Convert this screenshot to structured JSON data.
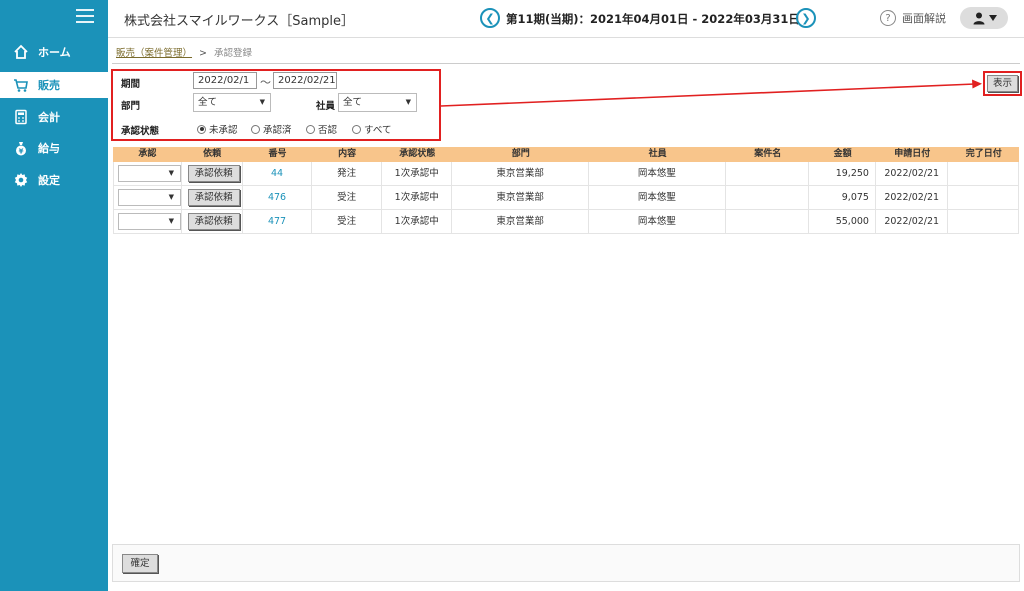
{
  "colors": {
    "sidebar": "#1b92b9",
    "accent": "#1b92b9",
    "table_header": "#f8c58b",
    "highlight_border": "#e12020"
  },
  "sidebar": {
    "items": [
      {
        "label": "ホーム",
        "icon": "home-icon",
        "active": false
      },
      {
        "label": "販売",
        "icon": "cart-icon",
        "active": true
      },
      {
        "label": "会計",
        "icon": "calculator-icon",
        "active": false
      },
      {
        "label": "給与",
        "icon": "money-bag-icon",
        "active": false
      },
      {
        "label": "設定",
        "icon": "gear-icon",
        "active": false
      }
    ]
  },
  "header": {
    "company": "株式会社スマイルワークス［Sample］",
    "period": "第11期(当期)：2021年04月01日 - 2022年03月31日",
    "prev_glyph": "❮",
    "next_glyph": "❯",
    "help_label": "画面解説",
    "help_glyph": "?"
  },
  "breadcrumb": {
    "parent": "販売（案件管理）",
    "separator": ">",
    "current": "承認登録"
  },
  "filter": {
    "period_label": "期間",
    "date_from": "2022/02/1",
    "tilde": "～",
    "date_to": "2022/02/21",
    "department_label": "部門",
    "department_value": "全て",
    "employee_label": "社員",
    "employee_value": "全て",
    "status_label": "承認状態",
    "status_options": [
      "未承認",
      "承認済",
      "否認",
      "すべて"
    ],
    "status_selected": 0
  },
  "show_button": "表示",
  "table": {
    "headers": [
      "承認",
      "依頼",
      "番号",
      "内容",
      "承認状態",
      "部門",
      "社員",
      "案件名",
      "金額",
      "申請日付",
      "完了日付"
    ],
    "request_label": "承認依頼",
    "rows": [
      {
        "number": "44",
        "content": "発注",
        "status": "1次承認中",
        "department": "東京営業部",
        "employee": "岡本悠聖",
        "case_name": "",
        "amount": "19,250",
        "applied": "2022/02/21",
        "completed": ""
      },
      {
        "number": "476",
        "content": "受注",
        "status": "1次承認中",
        "department": "東京営業部",
        "employee": "岡本悠聖",
        "case_name": "",
        "amount": "9,075",
        "applied": "2022/02/21",
        "completed": ""
      },
      {
        "number": "477",
        "content": "受注",
        "status": "1次承認中",
        "department": "東京営業部",
        "employee": "岡本悠聖",
        "case_name": "",
        "amount": "55,000",
        "applied": "2022/02/21",
        "completed": ""
      }
    ]
  },
  "footer": {
    "confirm_label": "確定"
  }
}
